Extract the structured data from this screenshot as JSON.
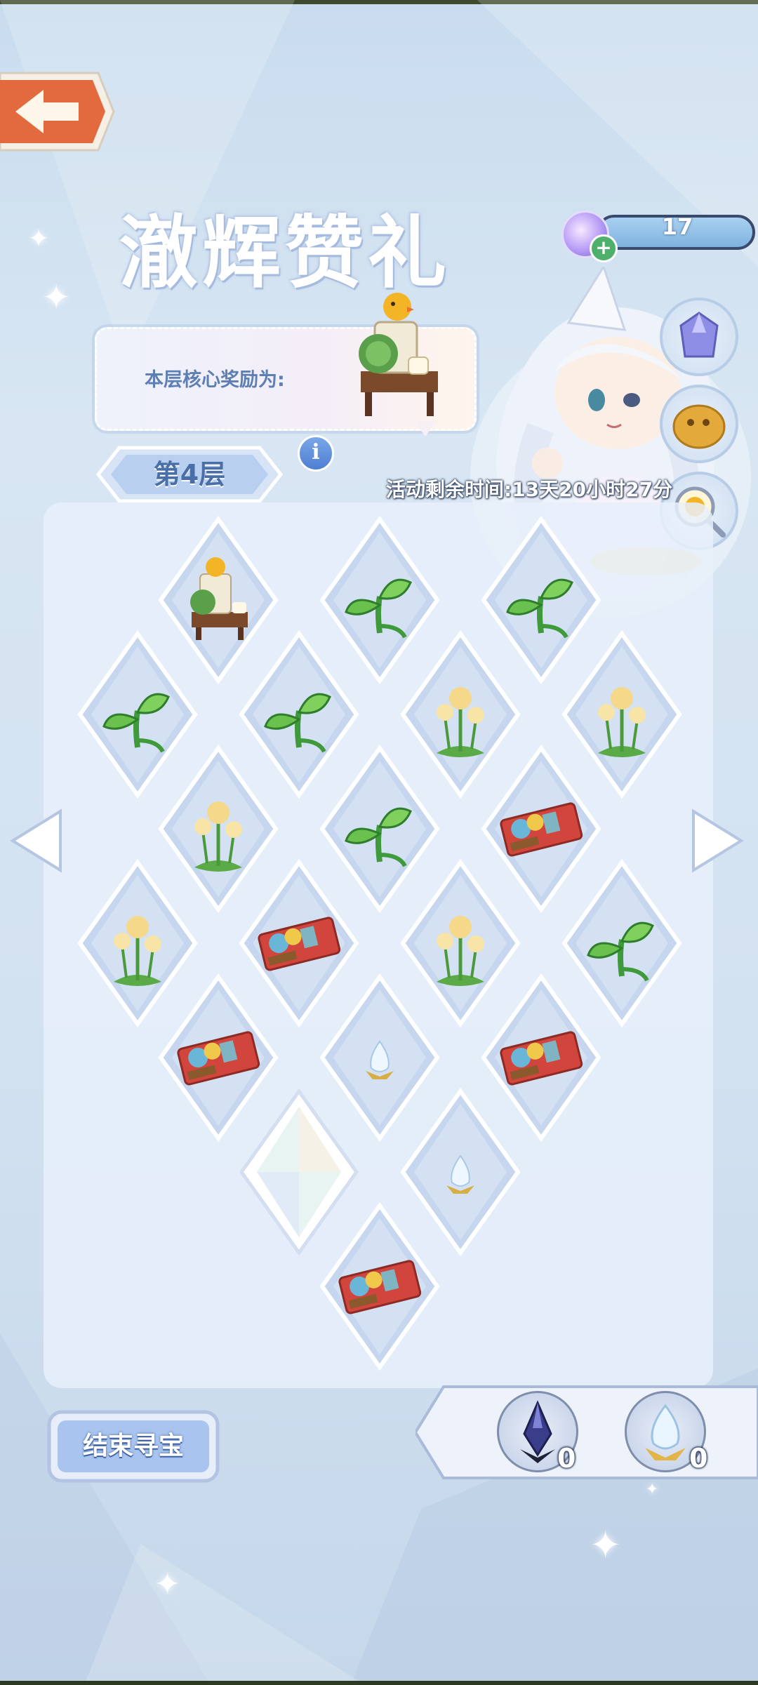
{
  "event": {
    "title": "澈辉赞礼",
    "reward_label": "本层核心奖励为:",
    "layer_label": "第4层",
    "timer_text": "活动剩余时间:13天20小时27分",
    "end_button_label": "结束寻宝"
  },
  "currency": {
    "value": "17",
    "icon": "crystal-orb-icon"
  },
  "inventory": [
    {
      "name": "dark-crystal",
      "count": "0"
    },
    {
      "name": "light-crystal-egg",
      "count": "0"
    }
  ],
  "side_buttons": [
    "crystal-bag-icon",
    "golden-lion-icon",
    "search-duck-icon"
  ],
  "grid_tiles": [
    {
      "row": 0,
      "col": 1,
      "item": "furniture"
    },
    {
      "row": 0,
      "col": 3,
      "item": "sprout"
    },
    {
      "row": 0,
      "col": 5,
      "item": "sprout"
    },
    {
      "row": 1,
      "col": 0,
      "item": "sprout"
    },
    {
      "row": 1,
      "col": 2,
      "item": "sprout"
    },
    {
      "row": 1,
      "col": 4,
      "item": "flower"
    },
    {
      "row": 1,
      "col": 6,
      "item": "flower"
    },
    {
      "row": 2,
      "col": 1,
      "item": "flower"
    },
    {
      "row": 2,
      "col": 3,
      "item": "sprout"
    },
    {
      "row": 2,
      "col": 5,
      "item": "ticket"
    },
    {
      "row": 3,
      "col": 0,
      "item": "flower"
    },
    {
      "row": 3,
      "col": 2,
      "item": "ticket"
    },
    {
      "row": 3,
      "col": 4,
      "item": "flower"
    },
    {
      "row": 3,
      "col": 6,
      "item": "sprout"
    },
    {
      "row": 4,
      "col": 1,
      "item": "ticket"
    },
    {
      "row": 4,
      "col": 3,
      "item": "egg"
    },
    {
      "row": 4,
      "col": 5,
      "item": "ticket"
    },
    {
      "row": 5,
      "col": 2,
      "item": "revealed"
    },
    {
      "row": 5,
      "col": 4,
      "item": "egg"
    },
    {
      "row": 6,
      "col": 3,
      "item": "ticket"
    }
  ],
  "colors": {
    "panel": "#e8f0fa",
    "tile": "#c9d8ee",
    "tile_border": "#ffffff",
    "accent": "#4a6fa8"
  }
}
